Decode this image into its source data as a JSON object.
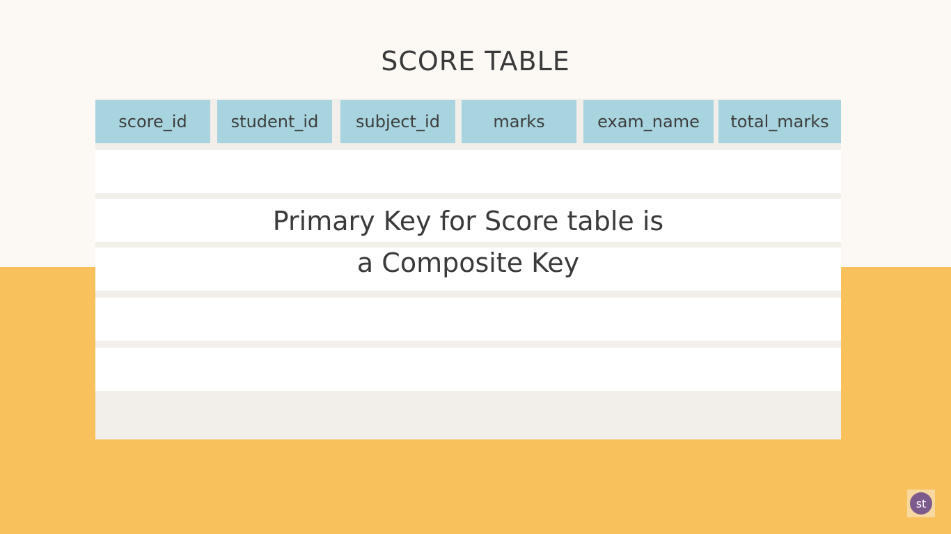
{
  "title": "SCORE TABLE",
  "columns": [
    "score_id",
    "student_id",
    "subject_id",
    "marks",
    "exam_name",
    "total_marks"
  ],
  "overlay": {
    "line1": "Primary Key for Score table is",
    "line2": "a Composite Key"
  },
  "logo": {
    "text": "st"
  },
  "colors": {
    "header_cell": "#a8d4e0",
    "bottom_band": "#f8c15c",
    "background": "#fcf9f4",
    "logo": "#7d5a8c"
  }
}
